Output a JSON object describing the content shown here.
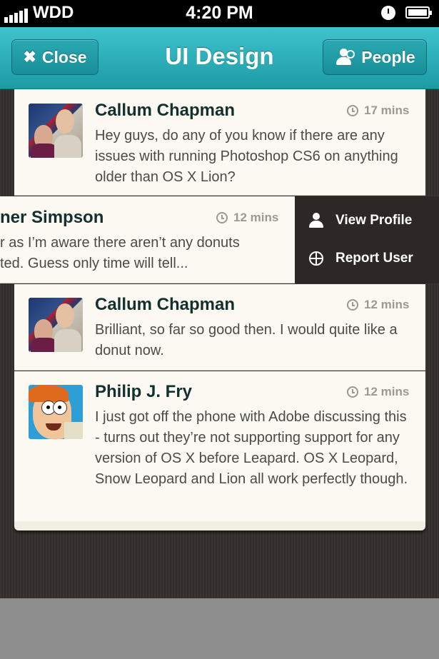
{
  "status_bar": {
    "carrier": "WDD",
    "time": "4:20 PM"
  },
  "nav": {
    "close_label": "Close",
    "title": "UI Design",
    "people_label": "People"
  },
  "messages": [
    {
      "name": "Callum Chapman",
      "time": "17 mins",
      "text": "Hey guys, do any of you know if there are any issues with running Photoshop CS6 on anything older than OS X Lion?"
    },
    {
      "name": "ner Simpson",
      "time": "12 mins",
      "line1": "r as I’m aware there aren’t any donuts",
      "line2": "ted. Guess only time will tell..."
    },
    {
      "name": "Callum Chapman",
      "time": "12 mins",
      "text": "Brilliant, so far so good then. I would quite like a donut now."
    },
    {
      "name": "Philip J. Fry",
      "time": "12 mins",
      "text": "I just got off the phone with Adobe discussing this - turns out they’re not supporting support for any version of OS X before Leapard. OS X Leopard, Snow Leopard and Lion all work perfectly though."
    }
  ],
  "actions": {
    "view_profile": "View Profile",
    "report_user": "Report User"
  },
  "icons": [
    "signal-icon",
    "clock-icon",
    "battery-icon",
    "close-icon",
    "people-icon",
    "time-icon",
    "user-icon",
    "target-icon"
  ],
  "colors": {
    "nav_teal": "#22a8b2",
    "card_bg": "#fbf9f2",
    "name_text": "#12302f",
    "action_bg": "#2d2826"
  }
}
